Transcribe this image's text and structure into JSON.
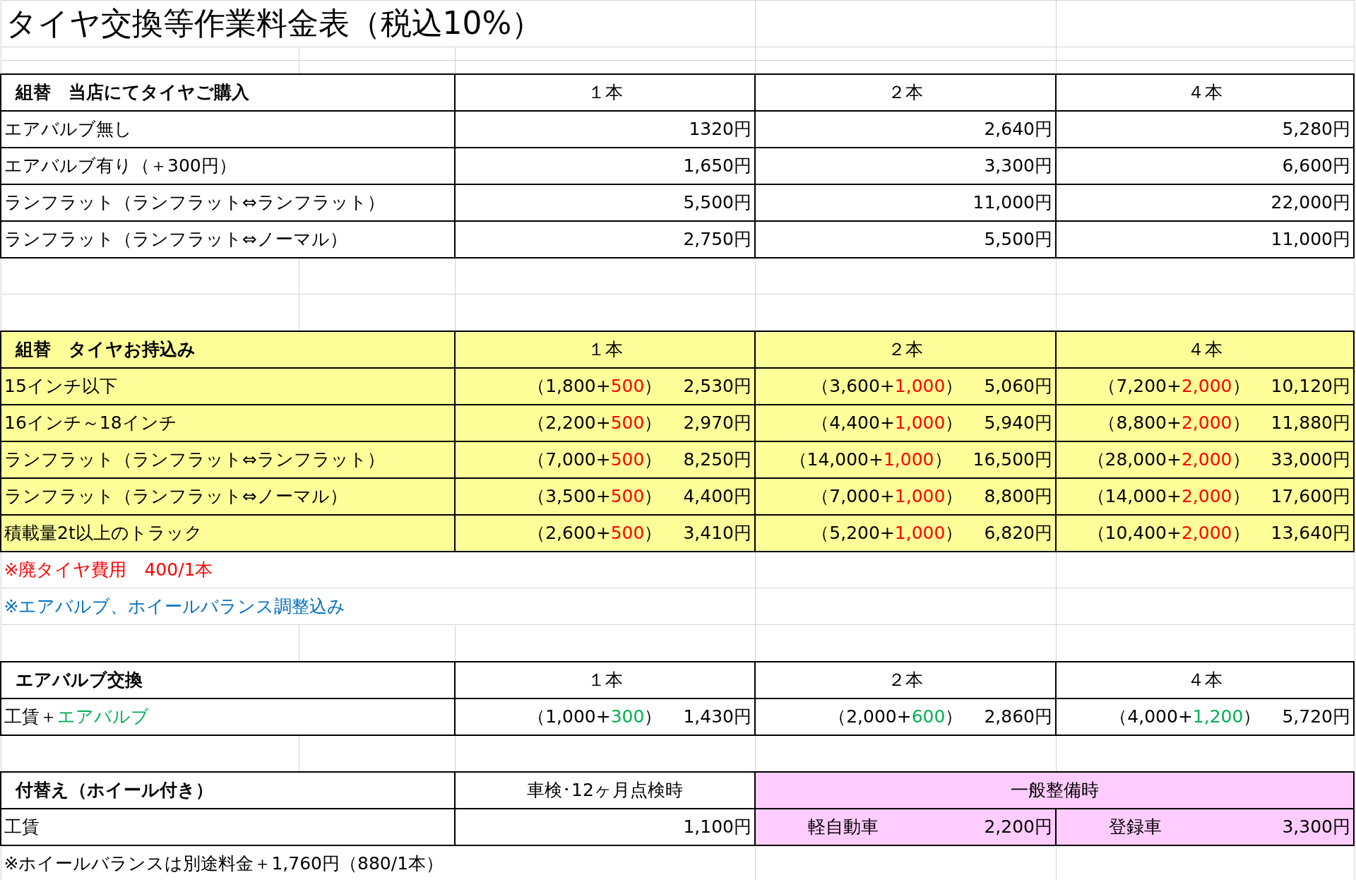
{
  "title": "タイヤ交換等作業料金表（税込10%）",
  "blocks": [
    {
      "kind": "thin"
    },
    {
      "kind": "thin"
    },
    {
      "kind": "table",
      "header": {
        "label": "組替　当店にてタイヤご購入",
        "columns": [
          "１本",
          "２本",
          "４本"
        ]
      },
      "rows": [
        {
          "label": "エアバルブ無し",
          "values": [
            {
              "total": "1320円"
            },
            {
              "total": "2,640円"
            },
            {
              "total": "5,280円"
            }
          ]
        },
        {
          "label": "エアバルブ有り（＋300円）",
          "values": [
            {
              "total": "1,650円"
            },
            {
              "total": "3,300円"
            },
            {
              "total": "6,600円"
            }
          ]
        },
        {
          "label": "ランフラット（ランフラット⇔ランフラット）",
          "values": [
            {
              "total": "5,500円"
            },
            {
              "total": "11,000円"
            },
            {
              "total": "22,000円"
            }
          ]
        },
        {
          "label": "ランフラット（ランフラット⇔ノーマル）",
          "values": [
            {
              "total": "2,750円"
            },
            {
              "total": "5,500円"
            },
            {
              "total": "11,000円"
            }
          ]
        }
      ]
    },
    {
      "kind": "blank"
    },
    {
      "kind": "blank"
    },
    {
      "kind": "table",
      "color": "#ffff99",
      "header": {
        "label": "組替　タイヤお持込み",
        "columns": [
          "１本",
          "２本",
          "４本"
        ]
      },
      "rows": [
        {
          "label": "15インチ以下",
          "values": [
            {
              "open": "（1,800+",
              "extra": {
                "text": "500",
                "color": "#ff0000"
              },
              "close": "）",
              "total": "2,530円"
            },
            {
              "open": "（3,600+",
              "extra": {
                "text": "1,000",
                "color": "#ff0000"
              },
              "close": "）",
              "total": "5,060円"
            },
            {
              "open": "（7,200+",
              "extra": {
                "text": "2,000",
                "color": "#ff0000"
              },
              "close": "）",
              "total": "10,120円"
            }
          ]
        },
        {
          "label": "16インチ～18インチ",
          "values": [
            {
              "open": "（2,200+",
              "extra": {
                "text": "500",
                "color": "#ff0000"
              },
              "close": "）",
              "total": "2,970円"
            },
            {
              "open": "（4,400+",
              "extra": {
                "text": "1,000",
                "color": "#ff0000"
              },
              "close": "）",
              "total": "5,940円"
            },
            {
              "open": "（8,800+",
              "extra": {
                "text": "2,000",
                "color": "#ff0000"
              },
              "close": "）",
              "total": "11,880円"
            }
          ]
        },
        {
          "label": "ランフラット（ランフラット⇔ランフラット）",
          "values": [
            {
              "open": "（7,000+",
              "extra": {
                "text": "500",
                "color": "#ff0000"
              },
              "close": "）",
              "total": "8,250円"
            },
            {
              "open": "（14,000+",
              "extra": {
                "text": "1,000",
                "color": "#ff0000"
              },
              "close": "）",
              "total": "16,500円"
            },
            {
              "open": "（28,000+",
              "extra": {
                "text": "2,000",
                "color": "#ff0000"
              },
              "close": "）",
              "total": "33,000円"
            }
          ]
        },
        {
          "label": "ランフラット（ランフラット⇔ノーマル）",
          "values": [
            {
              "open": "（3,500+",
              "extra": {
                "text": "500",
                "color": "#ff0000"
              },
              "close": "）",
              "total": "4,400円"
            },
            {
              "open": "（7,000+",
              "extra": {
                "text": "1,000",
                "color": "#ff0000"
              },
              "close": "）",
              "total": "8,800円"
            },
            {
              "open": "（14,000+",
              "extra": {
                "text": "2,000",
                "color": "#ff0000"
              },
              "close": "）",
              "total": "17,600円"
            }
          ]
        },
        {
          "label": "積載量2t以上のトラック",
          "values": [
            {
              "open": "（2,600+",
              "extra": {
                "text": "500",
                "color": "#ff0000"
              },
              "close": "）",
              "total": "3,410円"
            },
            {
              "open": "（5,200+",
              "extra": {
                "text": "1,000",
                "color": "#ff0000"
              },
              "close": "）",
              "total": "6,820円"
            },
            {
              "open": "（10,400+",
              "extra": {
                "text": "2,000",
                "color": "#ff0000"
              },
              "close": "）",
              "total": "13,640円"
            }
          ]
        }
      ]
    },
    {
      "kind": "note",
      "text": "※廃タイヤ費用　400/1本",
      "color": "#ff0000"
    },
    {
      "kind": "note",
      "text": "※エアバルブ、ホイールバランス調整込み",
      "color": "#0070c0"
    },
    {
      "kind": "blank"
    },
    {
      "kind": "table",
      "header": {
        "label": "エアバルブ交換",
        "columns": [
          "１本",
          "２本",
          "４本"
        ]
      },
      "rows": [
        {
          "label": "工賃＋",
          "label_extra": {
            "text": "エアバルブ",
            "color": "#00b050"
          },
          "values": [
            {
              "open": "（1,000+",
              "extra": {
                "text": "300",
                "color": "#00b050"
              },
              "close": "）",
              "total": "1,430円"
            },
            {
              "open": "（2,000+",
              "extra": {
                "text": "600",
                "color": "#00b050"
              },
              "close": "）",
              "total": "2,860円"
            },
            {
              "open": "（4,000+",
              "extra": {
                "text": "1,200",
                "color": "#00b050"
              },
              "close": "）",
              "total": "5,720円"
            }
          ]
        }
      ]
    },
    {
      "kind": "blank"
    },
    {
      "kind": "split",
      "header": {
        "label": "付替え（ホイール付き）",
        "column": "車検･12ヶ月点検時",
        "group": {
          "text": "一般整備時",
          "color": "#ffccff"
        }
      },
      "row": {
        "label": "工賃",
        "value": "1,100円",
        "subs": [
          {
            "label": "軽自動車",
            "value": "2,200円"
          },
          {
            "label": "登録車",
            "value": "3,300円"
          }
        ]
      }
    },
    {
      "kind": "note",
      "text": "※ホイールバランスは別途料金＋1,760円（880/1本）",
      "color": "#000000"
    }
  ]
}
